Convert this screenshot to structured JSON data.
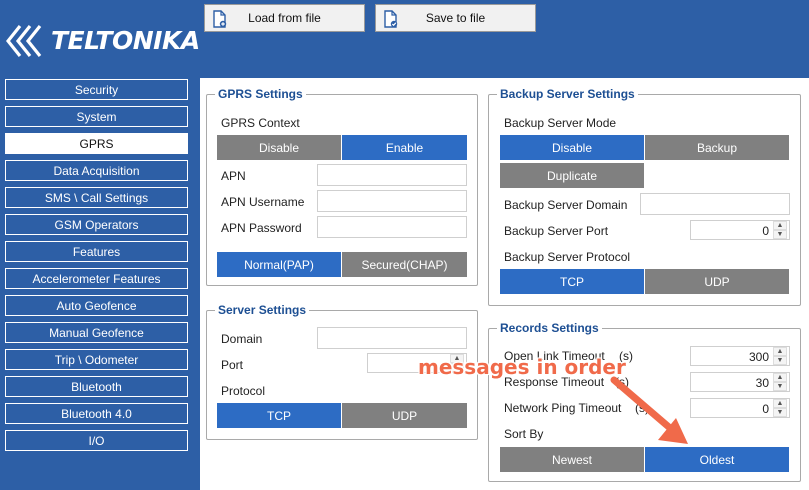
{
  "brand": {
    "logo_text": "TELTONIKA"
  },
  "toolbar": {
    "load_label": "Load from file",
    "save_label": "Save to file",
    "load_icon": "file-load-icon",
    "save_icon": "file-save-icon"
  },
  "sidebar": {
    "active": "GPRS",
    "items": [
      {
        "label": "Security"
      },
      {
        "label": "System"
      },
      {
        "label": "GPRS"
      },
      {
        "label": "Data Acquisition"
      },
      {
        "label": "SMS \\ Call Settings"
      },
      {
        "label": "GSM Operators"
      },
      {
        "label": "Features"
      },
      {
        "label": "Accelerometer Features"
      },
      {
        "label": "Auto Geofence"
      },
      {
        "label": "Manual Geofence"
      },
      {
        "label": "Trip \\ Odometer"
      },
      {
        "label": "Bluetooth"
      },
      {
        "label": "Bluetooth 4.0"
      },
      {
        "label": "I/O"
      }
    ]
  },
  "gprs": {
    "title": "GPRS Settings",
    "context_label": "GPRS Context",
    "context_options": {
      "disable": "Disable",
      "enable": "Enable",
      "selected": "Enable"
    },
    "apn_label": "APN",
    "apn_value": "",
    "username_label": "APN Username",
    "username_value": "",
    "password_label": "APN Password",
    "password_value": "",
    "auth_options": {
      "pap": "Normal(PAP)",
      "chap": "Secured(CHAP)",
      "selected": "Normal(PAP)"
    }
  },
  "server": {
    "title": "Server Settings",
    "domain_label": "Domain",
    "domain_value": "",
    "port_label": "Port",
    "port_value": "",
    "protocol_label": "Protocol",
    "protocol_options": {
      "tcp": "TCP",
      "udp": "UDP",
      "selected": "TCP"
    }
  },
  "backup": {
    "title": "Backup Server Settings",
    "mode_label": "Backup Server Mode",
    "mode_options": {
      "disable": "Disable",
      "backup": "Backup",
      "duplicate": "Duplicate",
      "selected": "Disable"
    },
    "domain_label": "Backup Server Domain",
    "domain_value": "",
    "port_label": "Backup Server Port",
    "port_value": "0",
    "protocol_label": "Backup Server Protocol",
    "protocol_options": {
      "tcp": "TCP",
      "udp": "UDP",
      "selected": "TCP"
    }
  },
  "records": {
    "title": "Records Settings",
    "open_link_label": "Open Link Timeout",
    "open_link_unit": "(s)",
    "open_link_value": "300",
    "response_label": "Response Timeout",
    "response_unit": "(s)",
    "response_value": "30",
    "ping_label": "Network Ping Timeout",
    "ping_unit": "(s)",
    "ping_value": "0",
    "sort_label": "Sort By",
    "sort_options": {
      "newest": "Newest",
      "oldest": "Oldest",
      "selected": "Oldest"
    }
  },
  "annotation": {
    "text": "messages in order",
    "color": "#f06a4a"
  },
  "colors": {
    "brand_blue": "#2d5fa6",
    "selected_blue": "#2d6cc4",
    "unselected_gray": "#808080"
  }
}
